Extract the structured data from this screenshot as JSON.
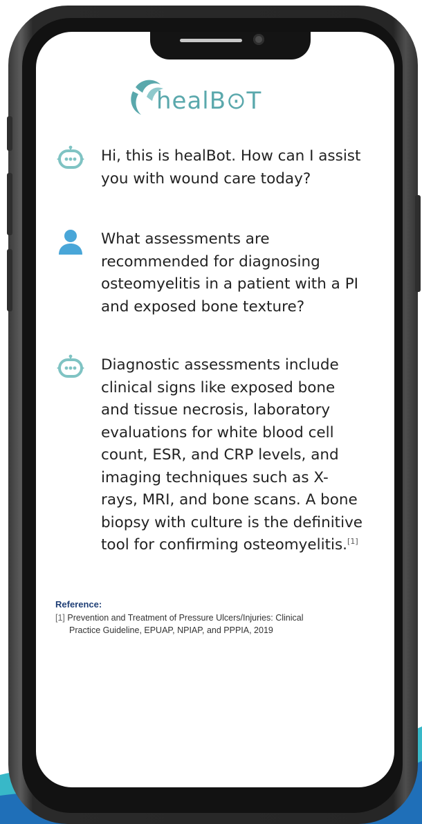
{
  "app": {
    "logo_text": "healBOT",
    "logo_text_display": "healB⊙T"
  },
  "colors": {
    "accent_teal": "#5aa8ac",
    "user_avatar_blue": "#49a6d8",
    "reference_title": "#1f3f76",
    "wave_blue": "#1f6fb8",
    "wave_teal": "#38b8c8"
  },
  "conversation": [
    {
      "role": "bot",
      "avatar_icon": "robot-icon",
      "text": "Hi, this is healBot. How can I assist you with wound care today?"
    },
    {
      "role": "user",
      "avatar_icon": "user-icon",
      "text": "What assessments are recommended for diagnosing osteomyelitis in a patient with a PI and exposed bone texture?"
    },
    {
      "role": "bot",
      "avatar_icon": "robot-icon",
      "text": "Diagnostic assessments include clinical signs like exposed bone and tissue necrosis, laboratory evaluations for white blood cell count, ESR, and CRP levels, and imaging techniques such as X-rays, MRI, and bone scans. A bone biopsy with culture is the definitive tool for confirming osteomyelitis.",
      "citation": "[1]"
    }
  ],
  "reference": {
    "title": "Reference:",
    "items": [
      {
        "number": "[1]",
        "line1": "Prevention and Treatment of Pressure Ulcers/Injuries: Clinical",
        "line2": "Practice Guideline, EPUAP, NPIAP, and PPPIA, 2019"
      }
    ]
  }
}
